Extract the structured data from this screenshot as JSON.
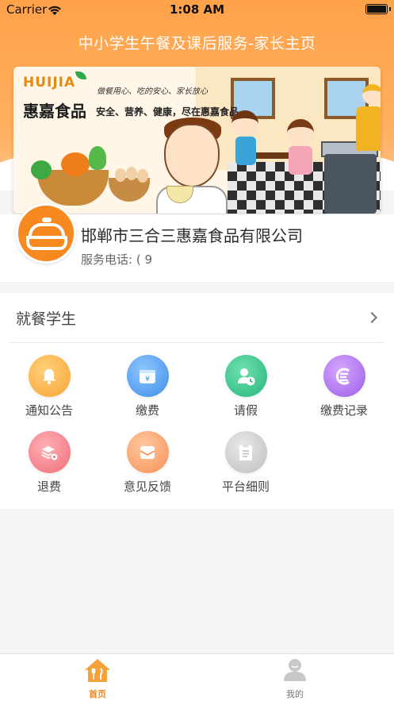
{
  "status_bar": {
    "carrier": "Carrier",
    "time": "1:08 AM"
  },
  "header": {
    "title": "中小学生午餐及课后服务-家长主页"
  },
  "banner": {
    "logo_en": "HUIJIA",
    "logo_cn": "惠嘉食品",
    "slogan_handwritten": "做餐用心、吃的安心、家长放心",
    "slogan": "安全、营养、健康，尽在惠嘉食品"
  },
  "company": {
    "name": "邯郸市三合三惠嘉食品有限公司",
    "phone": "服务电话: (              9"
  },
  "section": {
    "title": "就餐学生",
    "items": [
      {
        "label": "通知公告",
        "icon": "bell-icon"
      },
      {
        "label": "缴费",
        "icon": "wallet-icon"
      },
      {
        "label": "请假",
        "icon": "user-clock-icon"
      },
      {
        "label": "缴费记录",
        "icon": "record-icon"
      },
      {
        "label": "退费",
        "icon": "layers-gear-icon"
      },
      {
        "label": "意见反馈",
        "icon": "envelope-icon"
      },
      {
        "label": "平台细则",
        "icon": "clipboard-icon"
      }
    ]
  },
  "tabbar": {
    "tabs": [
      {
        "label": "首页",
        "icon": "home-icon",
        "active": true
      },
      {
        "label": "我的",
        "icon": "user-icon",
        "active": false
      }
    ]
  },
  "colors": {
    "accent": "#f28a1e",
    "header": "#ffa24a"
  }
}
